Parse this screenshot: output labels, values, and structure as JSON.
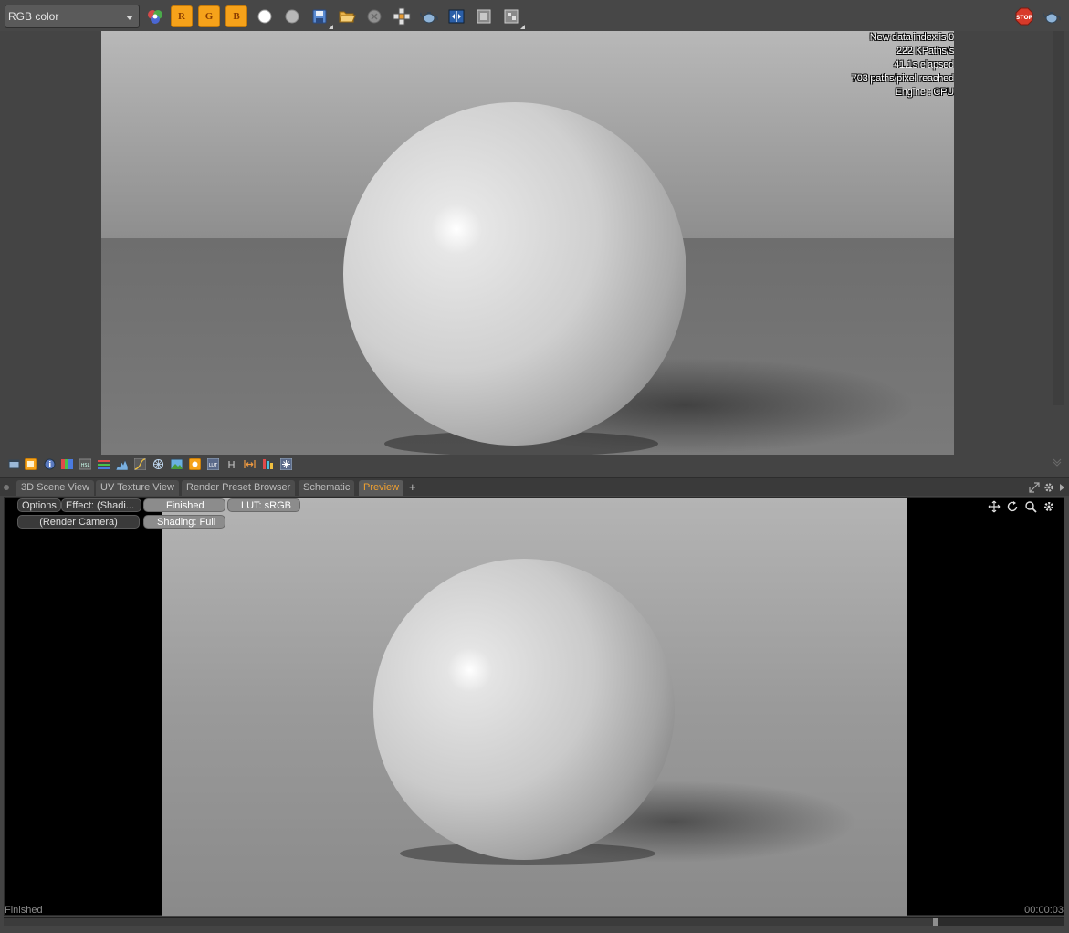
{
  "toolbar": {
    "channel_select": "RGB color",
    "channel_buttons": [
      {
        "name": "red-channel",
        "label": "R"
      },
      {
        "name": "green-channel",
        "label": "G"
      },
      {
        "name": "blue-channel",
        "label": "B"
      }
    ]
  },
  "render_info": {
    "lines": [
      "New data index is 0",
      "222 KPaths/s",
      "41.1s elapsed",
      "703 paths/pixel reached",
      "Engine : CPU"
    ]
  },
  "tabs": [
    {
      "label": "3D Scene View",
      "active": false
    },
    {
      "label": "UV Texture View",
      "active": false
    },
    {
      "label": "Render Preset Browser",
      "active": false
    },
    {
      "label": "Schematic",
      "active": false
    },
    {
      "label": "Preview",
      "active": true
    }
  ],
  "tab_add_label": "+",
  "preview": {
    "options_label": "Options",
    "effect_label": "Effect: (Shadi...",
    "state_label": "Finished",
    "lut_label": "LUT: sRGB",
    "camera_label": "(Render Camera)",
    "shading_label": "Shading: Full"
  },
  "status": {
    "text": "Finished",
    "time": "00:00:03",
    "progress": 1.0
  },
  "colors": {
    "accent_orange": "#f6a21a",
    "active_tab_text": "#f0a030",
    "panel_bg": "#444444",
    "stop_red": "#d83a2a"
  }
}
